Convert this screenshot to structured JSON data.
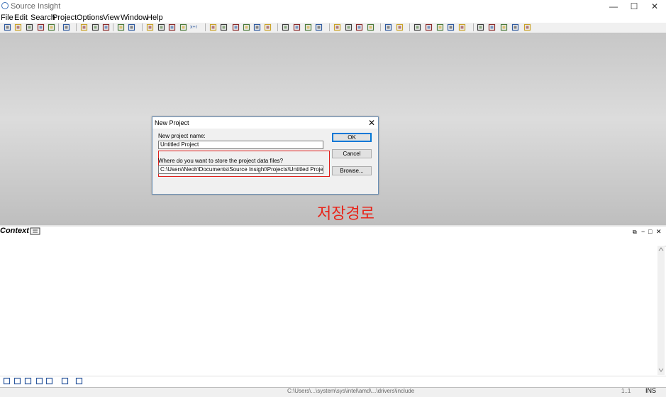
{
  "window": {
    "title": "Source Insight",
    "controls": {
      "minimize": "—",
      "maximize": "☐",
      "close": "✕"
    }
  },
  "menu": [
    "File",
    "Edit",
    "Search",
    "Project",
    "Options",
    "View",
    "Window",
    "Help"
  ],
  "toolbar": {
    "icons": [
      "new-file-icon",
      "open-folder-icon",
      "save-icon",
      "save-as-icon",
      "save-all-icon",
      "print-icon",
      "cut-icon",
      "copy-icon",
      "paste-icon",
      "undo-icon",
      "redo-icon",
      "search-icon",
      "search-files-icon",
      "search-project-icon",
      "search-replace-icon",
      "xref-icon",
      "bookmark-icon",
      "bookmark-list-icon",
      "back-icon",
      "forward-icon",
      "jump-icon",
      "jump-list-icon",
      "symbol-window-icon",
      "browse-icon",
      "book-icon",
      "relation-icon",
      "layout-icon",
      "window-icon",
      "split-icon",
      "cascade-icon",
      "type-info-icon",
      "cursor-help-icon",
      "eye-icon",
      "context-window-icon",
      "outline-icon",
      "graph-icon",
      "clip-icon",
      "globe-search-icon",
      "globe-icon",
      "globe-delete-icon",
      "globe-list-icon",
      "globe-add-icon"
    ],
    "xref_text": "x+r",
    "brand_color": "#3b6fb6"
  },
  "dialog": {
    "title": "New Project",
    "close": "✕",
    "name_label": "New project name:",
    "name_value": "Untitled Project",
    "location_label": "Where do you want to store the project data files?",
    "location_value": "C:\\Users\\Neoh\\Documents\\Source Insight\\Projects\\Untitled Project",
    "ok_label": "OK",
    "cancel_label": "Cancel",
    "browse_label": "Browse..."
  },
  "annotation": {
    "text": "저장경로",
    "color": "#e8241a"
  },
  "context_panel": {
    "title": "Context",
    "header_controls": [
      "⧉",
      "−",
      "□",
      "✕"
    ],
    "toolbar_icons": [
      "symbol-icon",
      "jump-icon",
      "book-icon",
      "relation-icon",
      "abc-icon",
      "lock-icon",
      "print-icon"
    ]
  },
  "statusbar": {
    "path": "C:\\Users\\...\\system\\sys\\intel\\amd\\...\\drivers\\include",
    "number": "1..1",
    "mode": "INS"
  }
}
